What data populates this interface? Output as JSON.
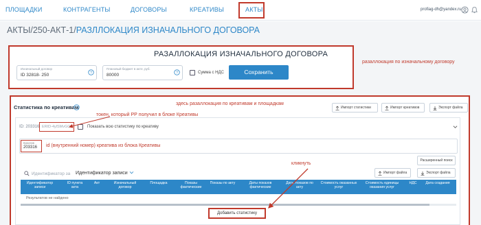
{
  "nav": {
    "items": [
      "ПЛОЩАДКИ",
      "КОНТРАГЕНТЫ",
      "ДОГОВОРЫ",
      "КРЕАТИВЫ",
      "АКТЫ"
    ],
    "user_email": "profiag-dh@yandex.ru"
  },
  "breadcrumb": {
    "part1": "АКТЫ",
    "sep": "/",
    "part2": "250-АКТ-1",
    "current": "РАЗЛЛОКАЦИЯ ИЗНАЧАЛЬНОГО ДОГОВОРА"
  },
  "header": {
    "title": "РАЗАЛЛОКАЦИЯ ИЗНАЧАЛЬНОГО ДОГОВОРА",
    "initial_contract_label": "Изначальный договор",
    "initial_contract_value": "ID 32818- 250",
    "planned_budget_label": "Плановый бюджет в акте, руб.",
    "planned_budget_value": "80000",
    "vat_label": "Сумма с НДС",
    "save_label": "Сохранить"
  },
  "annotations": {
    "realloc": "разаллокация по изначальному договору",
    "stats_here": "здесь разаллокация по креативам и площадкам",
    "token": "токен, который РР получил в блоке Креативы",
    "creative_id": "id (внутренний номер) креатива из блока Креативы",
    "clicked": "кликнуть"
  },
  "stats": {
    "title": "Статистика по креативам",
    "import_stats": "Импорт статистики",
    "import_creatives": "Импорт креативов",
    "export_file": "Экспорт файла",
    "id_label": "ID: 203316",
    "token_value": "ERID-4ylSMvGO3",
    "show_all_label": "Показать всю статистику по креативу",
    "creative_label": "Креатив",
    "creative_value": "203316",
    "extended_search": "Расширенный поиск",
    "search_placeholder": "Идентификатор за",
    "record_id_label": "Идентификатор записи",
    "import_file": "Импорт файла",
    "export_file2": "Экспорт файла",
    "empty": "Результатов не найдено",
    "add_stat": "Добавить статистику"
  },
  "table": {
    "headers": [
      "Идентификатор записи",
      "ID пункта акта",
      "Акт",
      "Изначальный договор",
      "Площадка",
      "Показы фактические",
      "Показы по акту",
      "Даты показов фактические",
      "Даты показов по акту",
      "Стоимость оказанных услуг",
      "Стоимость единицы оказания услуг",
      "НДС",
      "Дата создания"
    ]
  },
  "colors": {
    "accent": "#2d87c8",
    "annotation_red": "#c0392b"
  }
}
